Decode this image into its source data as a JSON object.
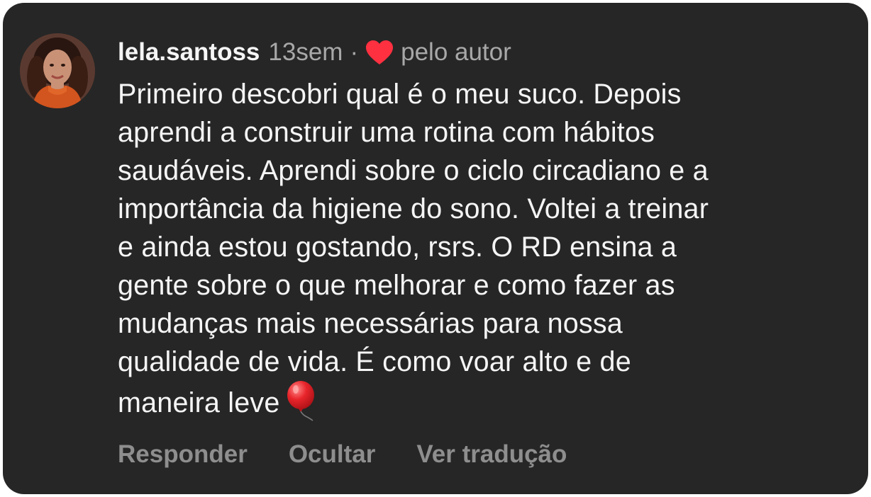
{
  "comment": {
    "username": "lela.santoss",
    "time": "13sem",
    "separator": "·",
    "liked_by": "pelo autor",
    "text": "Primeiro descobri qual é o meu suco. Depois\naprendi a construir uma rotina com hábitos\nsaudáveis. Aprendi sobre o ciclo circadiano e a\nimportância da higiene do sono. Voltei a treinar\ne ainda estou gostando, rsrs. O RD ensina a\ngente sobre o que melhorar e como fazer as\nmudanças mais necessárias para nossa\nqualidade de vida. É como voar alto e de\nmaneira leve",
    "emoji": "balloon-emoji"
  },
  "actions": {
    "reply": "Responder",
    "hide": "Ocultar",
    "translate": "Ver tradução"
  },
  "icons": {
    "heart": "heart-icon",
    "avatar": "avatar"
  },
  "colors": {
    "background": "#262626",
    "text": "#f5f5f5",
    "muted": "#a8a8a8",
    "action": "#8e8e8e",
    "heart": "#ff3040"
  }
}
